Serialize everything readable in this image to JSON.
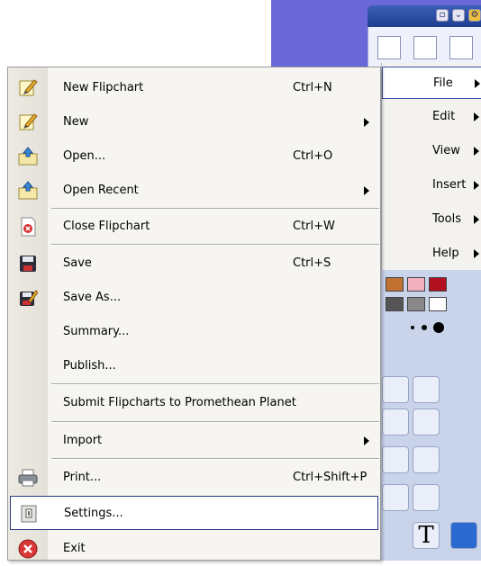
{
  "menubar": {
    "items": [
      {
        "label": "File",
        "selected": true
      },
      {
        "label": "Edit"
      },
      {
        "label": "View"
      },
      {
        "label": "Insert"
      },
      {
        "label": "Tools"
      },
      {
        "label": "Help"
      }
    ]
  },
  "file_menu": {
    "items": [
      {
        "label": "New Flipchart",
        "shortcut": "Ctrl+N",
        "icon": "new-flipchart-icon"
      },
      {
        "label": "New",
        "submenu": true,
        "icon": "new-icon"
      },
      {
        "label": "Open...",
        "shortcut": "Ctrl+O",
        "icon": "open-folder-icon"
      },
      {
        "label": "Open Recent",
        "submenu": true,
        "icon": "open-recent-icon"
      },
      {
        "label": "Close Flipchart",
        "shortcut": "Ctrl+W",
        "icon": "close-flipchart-icon"
      },
      {
        "label": "Save",
        "shortcut": "Ctrl+S",
        "icon": "save-icon"
      },
      {
        "label": "Save As...",
        "icon": "save-as-icon"
      },
      {
        "label": "Summary..."
      },
      {
        "label": "Publish..."
      },
      {
        "label": "Submit Flipcharts to Promethean Planet"
      },
      {
        "label": "Import",
        "submenu": true
      },
      {
        "label": "Print...",
        "shortcut": "Ctrl+Shift+P",
        "icon": "printer-icon"
      },
      {
        "label": "Settings...",
        "icon": "settings-icon",
        "highlighted": true
      },
      {
        "label": "Exit",
        "icon": "exit-icon"
      }
    ]
  },
  "colors": {
    "menu_bg": "#f6f5f1",
    "highlight_border": "#2c3b86",
    "app_bg": "#6a67d8",
    "palette_bg": "#c9d4ea"
  }
}
